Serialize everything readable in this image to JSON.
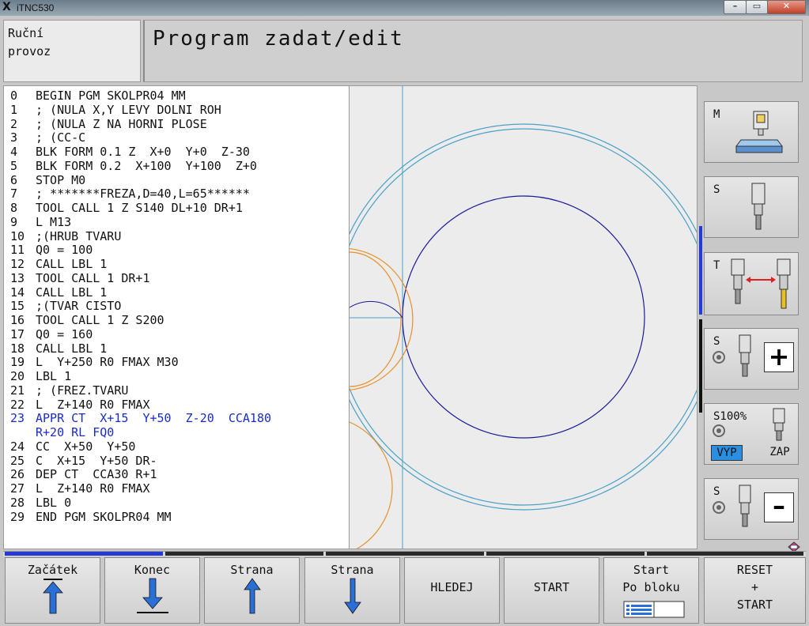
{
  "window": {
    "title": "iTNC530"
  },
  "mode": {
    "line1": "Ruční",
    "line2": "provoz"
  },
  "header": {
    "title": "Program zadat/edit"
  },
  "program": {
    "lines": [
      {
        "n": "0",
        "text": "BEGIN PGM SKOLPR04 MM"
      },
      {
        "n": "1",
        "text": "; (NULA X,Y LEVY DOLNI ROH"
      },
      {
        "n": "2",
        "text": "; (NULA Z NA HORNI PLOSE"
      },
      {
        "n": "3",
        "text": "; (CC-C"
      },
      {
        "n": "4",
        "text": "BLK FORM 0.1 Z  X+0  Y+0  Z-30"
      },
      {
        "n": "5",
        "text": "BLK FORM 0.2  X+100  Y+100  Z+0"
      },
      {
        "n": "6",
        "text": "STOP M0"
      },
      {
        "n": "7",
        "text": "; *******FREZA,D=40,L=65******"
      },
      {
        "n": "8",
        "text": "TOOL CALL 1 Z S140 DL+10 DR+1"
      },
      {
        "n": "9",
        "text": "L M13"
      },
      {
        "n": "10",
        "text": ";(HRUB TVARU"
      },
      {
        "n": "11",
        "text": "Q0 = 100"
      },
      {
        "n": "12",
        "text": "CALL LBL 1"
      },
      {
        "n": "13",
        "text": "TOOL CALL 1 DR+1"
      },
      {
        "n": "14",
        "text": "CALL LBL 1"
      },
      {
        "n": "15",
        "text": ";(TVAR CISTO"
      },
      {
        "n": "16",
        "text": "TOOL CALL 1 Z S200"
      },
      {
        "n": "17",
        "text": "Q0 = 160"
      },
      {
        "n": "18",
        "text": "CALL LBL 1"
      },
      {
        "n": "19",
        "text": "L  Y+250 R0 FMAX M30"
      },
      {
        "n": "20",
        "text": "LBL 1"
      },
      {
        "n": "21",
        "text": "; (FREZ.TVARU"
      },
      {
        "n": "22",
        "text": "L  Z+140 R0 FMAX"
      },
      {
        "n": "23",
        "text": "APPR CT  X+15  Y+50  Z-20  CCA180"
      },
      {
        "n": "",
        "text": "R+20 RL FQ0"
      },
      {
        "n": "24",
        "text": "CC  X+50  Y+50"
      },
      {
        "n": "25",
        "text": "C  X+15  Y+50 DR-"
      },
      {
        "n": "26",
        "text": "DEP CT  CCA30 R+1"
      },
      {
        "n": "27",
        "text": "L  Z+140 R0 FMAX"
      },
      {
        "n": "28",
        "text": "LBL 0"
      },
      {
        "n": "29",
        "text": "END PGM SKOLPR04 MM"
      }
    ],
    "active_line": "23"
  },
  "side_softkeys": {
    "m": {
      "label": "M",
      "icon": "machine-icon"
    },
    "s_spindle": {
      "label": "S",
      "icon": "spindle-tool-icon"
    },
    "t": {
      "label": "T",
      "icon": "tool-change-icon"
    },
    "s_plus": {
      "label": "S",
      "icon": "spindle-plus-icon"
    },
    "s_override": {
      "label": "S100%",
      "off": "VYP",
      "on": "ZAP"
    },
    "s_minus": {
      "label": "S",
      "icon": "spindle-minus-icon"
    }
  },
  "softkeys": [
    {
      "line1": "Začátek",
      "icon": "arrow-up-bar-icon"
    },
    {
      "line1": "Konec",
      "icon": "arrow-down-bar-icon"
    },
    {
      "line1": "Strana",
      "icon": "arrow-up-icon"
    },
    {
      "line1": "Strana",
      "icon": "arrow-down-icon"
    },
    {
      "line1": "HLEDEJ"
    },
    {
      "line1": "START"
    },
    {
      "line1": "Start",
      "line2": "Po bloku",
      "icon": "block-icon"
    },
    {
      "line1": "RESET",
      "line2": "+",
      "line3": "START"
    }
  ],
  "colors": {
    "active_line": "#1a2cc8",
    "contour_blue": "#1a1a9a",
    "contour_light": "#4aa0c8",
    "orange": "#e8902a",
    "zap_highlight": "#2a8fe0"
  }
}
